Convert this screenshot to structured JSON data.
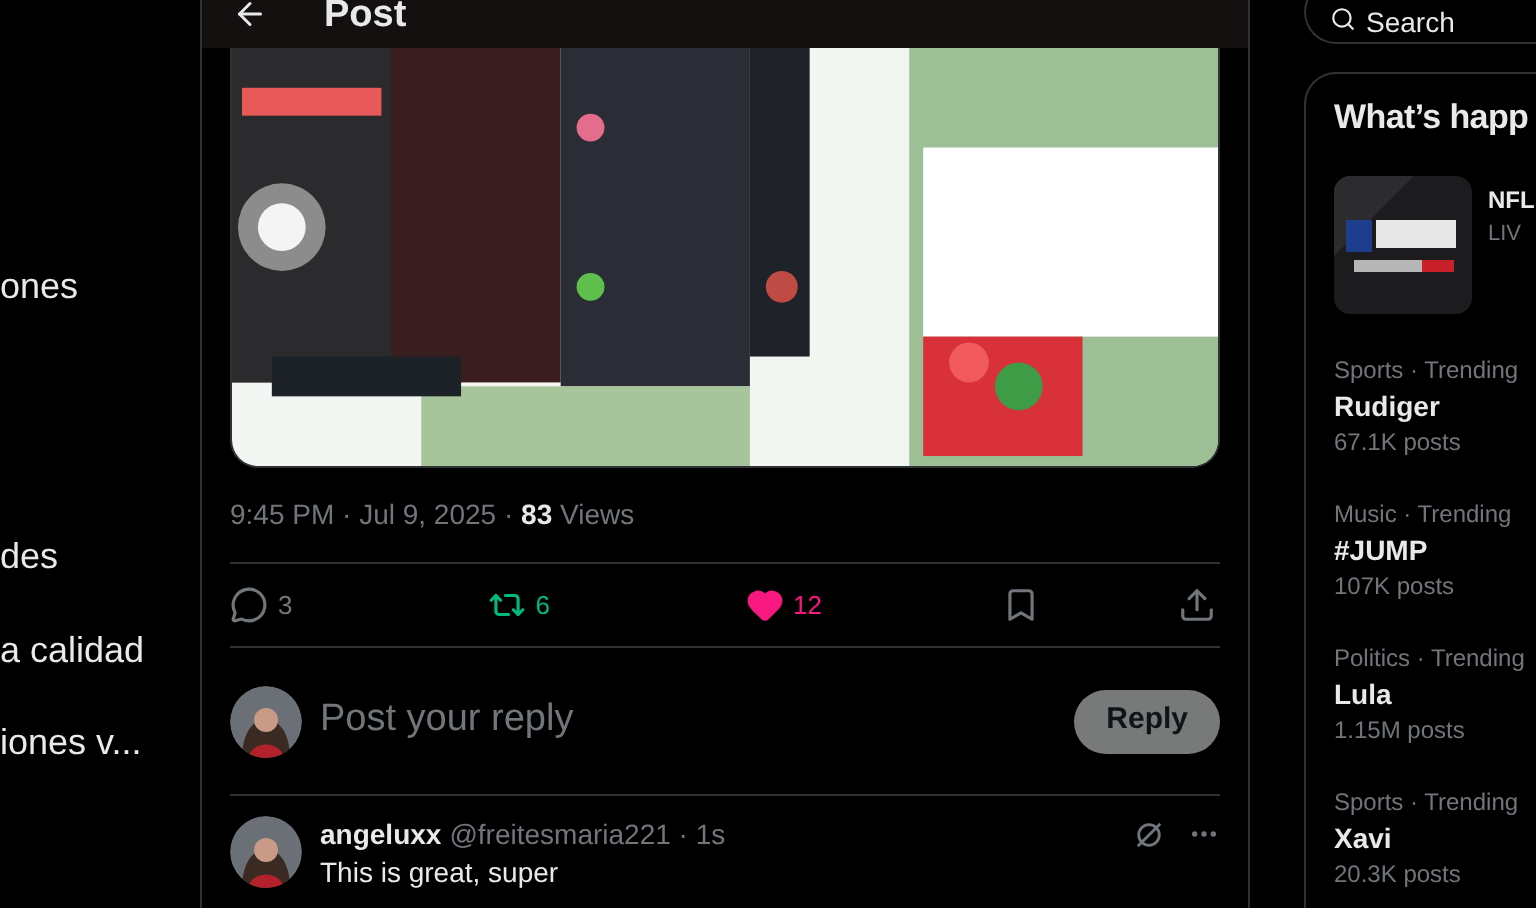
{
  "nav": {
    "items": [
      "ones",
      "des",
      "a calidad",
      "iones v..."
    ]
  },
  "header": {
    "title": "Post"
  },
  "post": {
    "timestamp": "9:45 PM · Jul 9, 2025 · ",
    "views_count": "83",
    "views_label": "Views",
    "actions": [
      {
        "kind": "reply",
        "count": "3"
      },
      {
        "kind": "repost",
        "count": "6",
        "active": true
      },
      {
        "kind": "like",
        "count": "12",
        "active": true
      },
      {
        "kind": "bookmark"
      },
      {
        "kind": "share"
      }
    ]
  },
  "composer": {
    "placeholder": "Post your reply",
    "button": "Reply",
    "disabled": true
  },
  "replies": [
    {
      "name": "angeluxx",
      "handle": "@freitesmaria221 · 1s",
      "text": "This is great, super"
    }
  ],
  "search": {
    "placeholder": "Search"
  },
  "trends": {
    "title": "What’s happ",
    "featured": {
      "title": "NFL",
      "subtitle": "LIV"
    },
    "items": [
      {
        "context": "Sports · Trending",
        "name": "Rudiger",
        "posts": "67.1K posts"
      },
      {
        "context": "Music · Trending",
        "name": "#JUMP",
        "posts": "107K posts"
      },
      {
        "context": "Politics · Trending",
        "name": "Lula",
        "posts": "1.15M posts"
      },
      {
        "context": "Sports · Trending",
        "name": "Xavi",
        "posts": "20.3K posts"
      }
    ]
  }
}
